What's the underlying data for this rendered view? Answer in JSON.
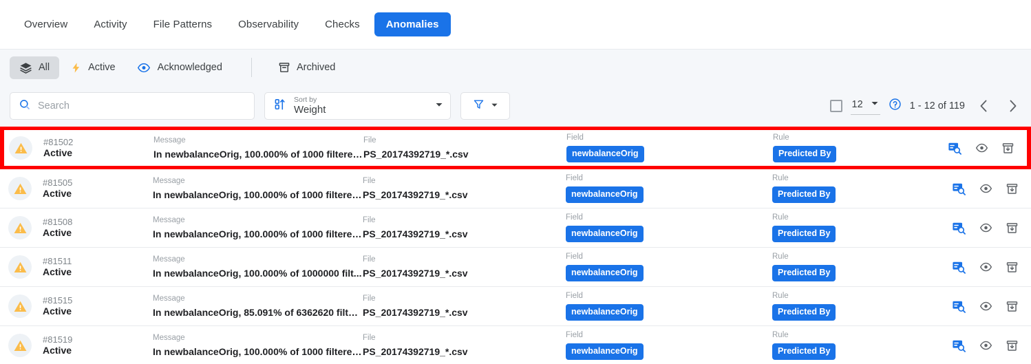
{
  "nav_tabs": [
    {
      "label": "Overview",
      "active": false
    },
    {
      "label": "Activity",
      "active": false
    },
    {
      "label": "File Patterns",
      "active": false
    },
    {
      "label": "Observability",
      "active": false
    },
    {
      "label": "Checks",
      "active": false
    },
    {
      "label": "Anomalies",
      "active": true
    }
  ],
  "status_filters": [
    {
      "label": "All",
      "icon": "layers-icon",
      "selected": true
    },
    {
      "label": "Active",
      "icon": "bolt-icon",
      "selected": false
    },
    {
      "label": "Acknowledged",
      "icon": "eye-icon",
      "selected": false
    },
    {
      "label": "Archived",
      "icon": "archive-icon",
      "selected": false
    }
  ],
  "toolbar": {
    "search_placeholder": "Search",
    "search_value": "",
    "search_icon": "search-icon",
    "sort_label": "Sort by",
    "sort_value": "Weight",
    "sort_icon": "sort-numeric-icon",
    "filter_icon": "funnel-icon"
  },
  "pagination": {
    "page_size": "12",
    "help_icon": "help-circle-icon",
    "range_text": "1 - 12 of 119",
    "prev_icon": "chevron-left-icon",
    "next_icon": "chevron-right-icon"
  },
  "columns": {
    "message": "Message",
    "file": "File",
    "field": "Field",
    "rule": "Rule"
  },
  "row_actions": [
    {
      "name": "inspect-icon"
    },
    {
      "name": "acknowledge-eye-icon"
    },
    {
      "name": "archive-icon"
    }
  ],
  "rows": [
    {
      "id": "#81502",
      "status": "Active",
      "message": "In newbalanceOrig, 100.000% of 1000 filtered ...",
      "file": "PS_20174392719_*.csv",
      "field": "newbalanceOrig",
      "rule": "Predicted By",
      "highlighted": true
    },
    {
      "id": "#81505",
      "status": "Active",
      "message": "In newbalanceOrig, 100.000% of 1000 filtered ...",
      "file": "PS_20174392719_*.csv",
      "field": "newbalanceOrig",
      "rule": "Predicted By",
      "highlighted": false
    },
    {
      "id": "#81508",
      "status": "Active",
      "message": "In newbalanceOrig, 100.000% of 1000 filtered ...",
      "file": "PS_20174392719_*.csv",
      "field": "newbalanceOrig",
      "rule": "Predicted By",
      "highlighted": false
    },
    {
      "id": "#81511",
      "status": "Active",
      "message": "In newbalanceOrig, 100.000% of 1000000 filt...",
      "file": "PS_20174392719_*.csv",
      "field": "newbalanceOrig",
      "rule": "Predicted By",
      "highlighted": false
    },
    {
      "id": "#81515",
      "status": "Active",
      "message": "In newbalanceOrig, 85.091% of 6362620 filter...",
      "file": "PS_20174392719_*.csv",
      "field": "newbalanceOrig",
      "rule": "Predicted By",
      "highlighted": false
    },
    {
      "id": "#81519",
      "status": "Active",
      "message": "In newbalanceOrig, 100.000% of 1000 filtered ...",
      "file": "PS_20174392719_*.csv",
      "field": "newbalanceOrig",
      "rule": "Predicted By",
      "highlighted": false
    }
  ],
  "colors": {
    "accent_blue": "#1a73e8",
    "warning_amber": "#fbbc4a",
    "highlight_red": "#ff0000",
    "bar_background": "#f5f7fa"
  }
}
